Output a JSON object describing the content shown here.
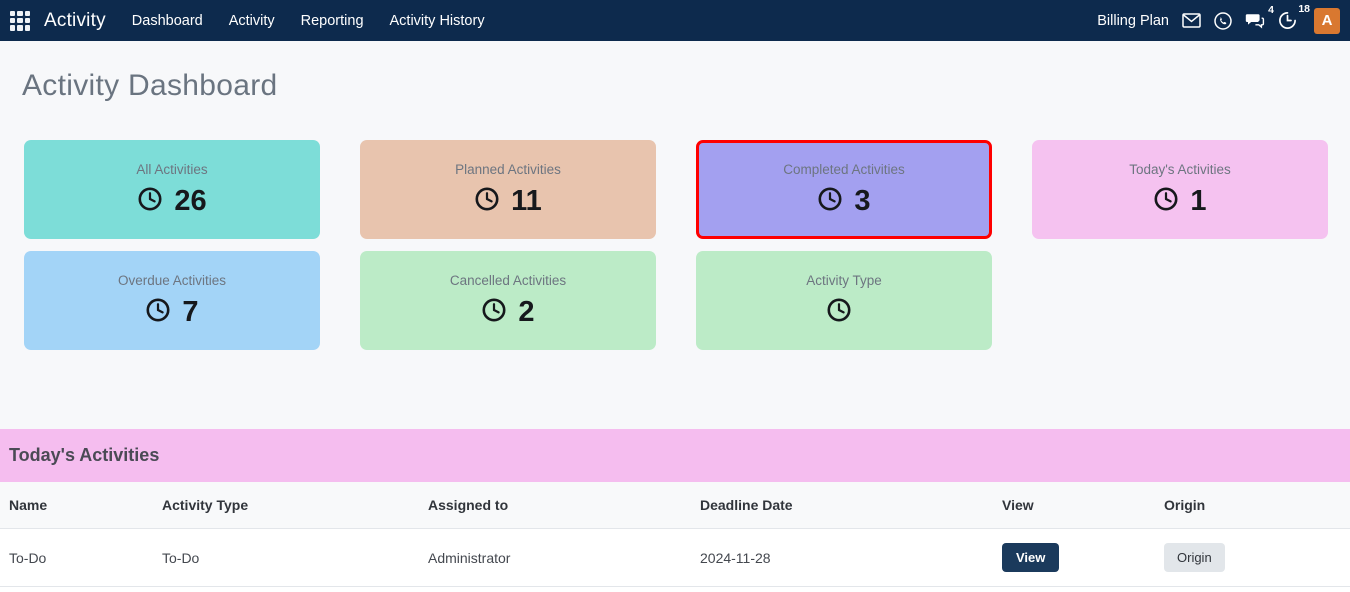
{
  "navbar": {
    "apps_icon": "grid-apps-icon",
    "brand": "Activity",
    "links": [
      {
        "label": "Dashboard"
      },
      {
        "label": "Activity"
      },
      {
        "label": "Reporting"
      },
      {
        "label": "Activity History"
      }
    ],
    "billing_label": "Billing Plan",
    "icons": [
      {
        "name": "mail-icon",
        "badge": ""
      },
      {
        "name": "whatsapp-icon",
        "badge": ""
      },
      {
        "name": "chat-icon",
        "badge": "4"
      },
      {
        "name": "activity-timer-icon",
        "badge": "18"
      }
    ],
    "avatar_initial": "A",
    "avatar_color": "#d97830",
    "background_color": "#0d2a4d"
  },
  "page": {
    "title": "Activity Dashboard",
    "background_color": "#f7f8fa"
  },
  "tiles": [
    {
      "title": "All Activities",
      "value": "26",
      "color": "#7dddd8",
      "icon": "clock-icon",
      "selected": false
    },
    {
      "title": "Overdue Activities",
      "value": "7",
      "color": "#a3d4f7",
      "icon": "clock-icon",
      "selected": false
    },
    {
      "title": "Planned Activities",
      "value": "11",
      "color": "#e8c4ae",
      "icon": "clock-icon",
      "selected": false
    },
    {
      "title": "Cancelled Activities",
      "value": "2",
      "color": "#bcebc7",
      "icon": "clock-icon",
      "selected": false
    },
    {
      "title": "Completed Activities",
      "value": "3",
      "color": "#a3a0f0",
      "icon": "clock-icon",
      "selected": true,
      "highlight_color": "#ff0000"
    },
    {
      "title": "Activity Type",
      "value": "",
      "color": "#bcebc7",
      "icon": "clock-icon",
      "selected": false
    },
    {
      "title": "Today's Activities",
      "value": "1",
      "color": "#f5c2f0",
      "icon": "clock-icon",
      "selected": false
    }
  ],
  "section": {
    "heading": "Today's Activities",
    "heading_color": "#f5bdef"
  },
  "table": {
    "columns": [
      "Name",
      "Activity Type",
      "Assigned to",
      "Deadline Date",
      "View",
      "Origin"
    ],
    "rows": [
      {
        "name": "To-Do",
        "activity_type": "To-Do",
        "assigned_to": "Administrator",
        "deadline_date": "2024-11-28",
        "view_label": "View",
        "origin_label": "Origin"
      }
    ]
  }
}
